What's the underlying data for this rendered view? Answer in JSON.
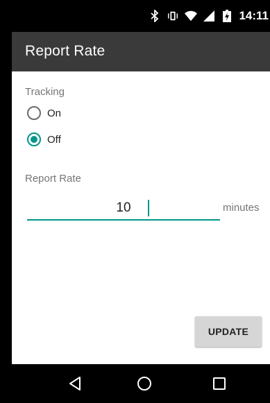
{
  "status_bar": {
    "time": "14:11",
    "icons": [
      "bluetooth-icon",
      "vibrate-icon",
      "wifi-icon",
      "signal-icon",
      "battery-charging-icon"
    ]
  },
  "app_bar": {
    "title": "Report Rate"
  },
  "tracking": {
    "label": "Tracking",
    "options": [
      {
        "label": "On",
        "checked": false
      },
      {
        "label": "Off",
        "checked": true
      }
    ]
  },
  "report_rate": {
    "label": "Report Rate",
    "value": "10",
    "unit": "minutes"
  },
  "actions": {
    "update_label": "UPDATE"
  },
  "nav_bar": {
    "icons": [
      "back-icon",
      "home-icon",
      "recents-icon"
    ]
  },
  "colors": {
    "accent": "#009688",
    "app_bar": "#3a3a3a",
    "button": "#d6d6d6"
  }
}
